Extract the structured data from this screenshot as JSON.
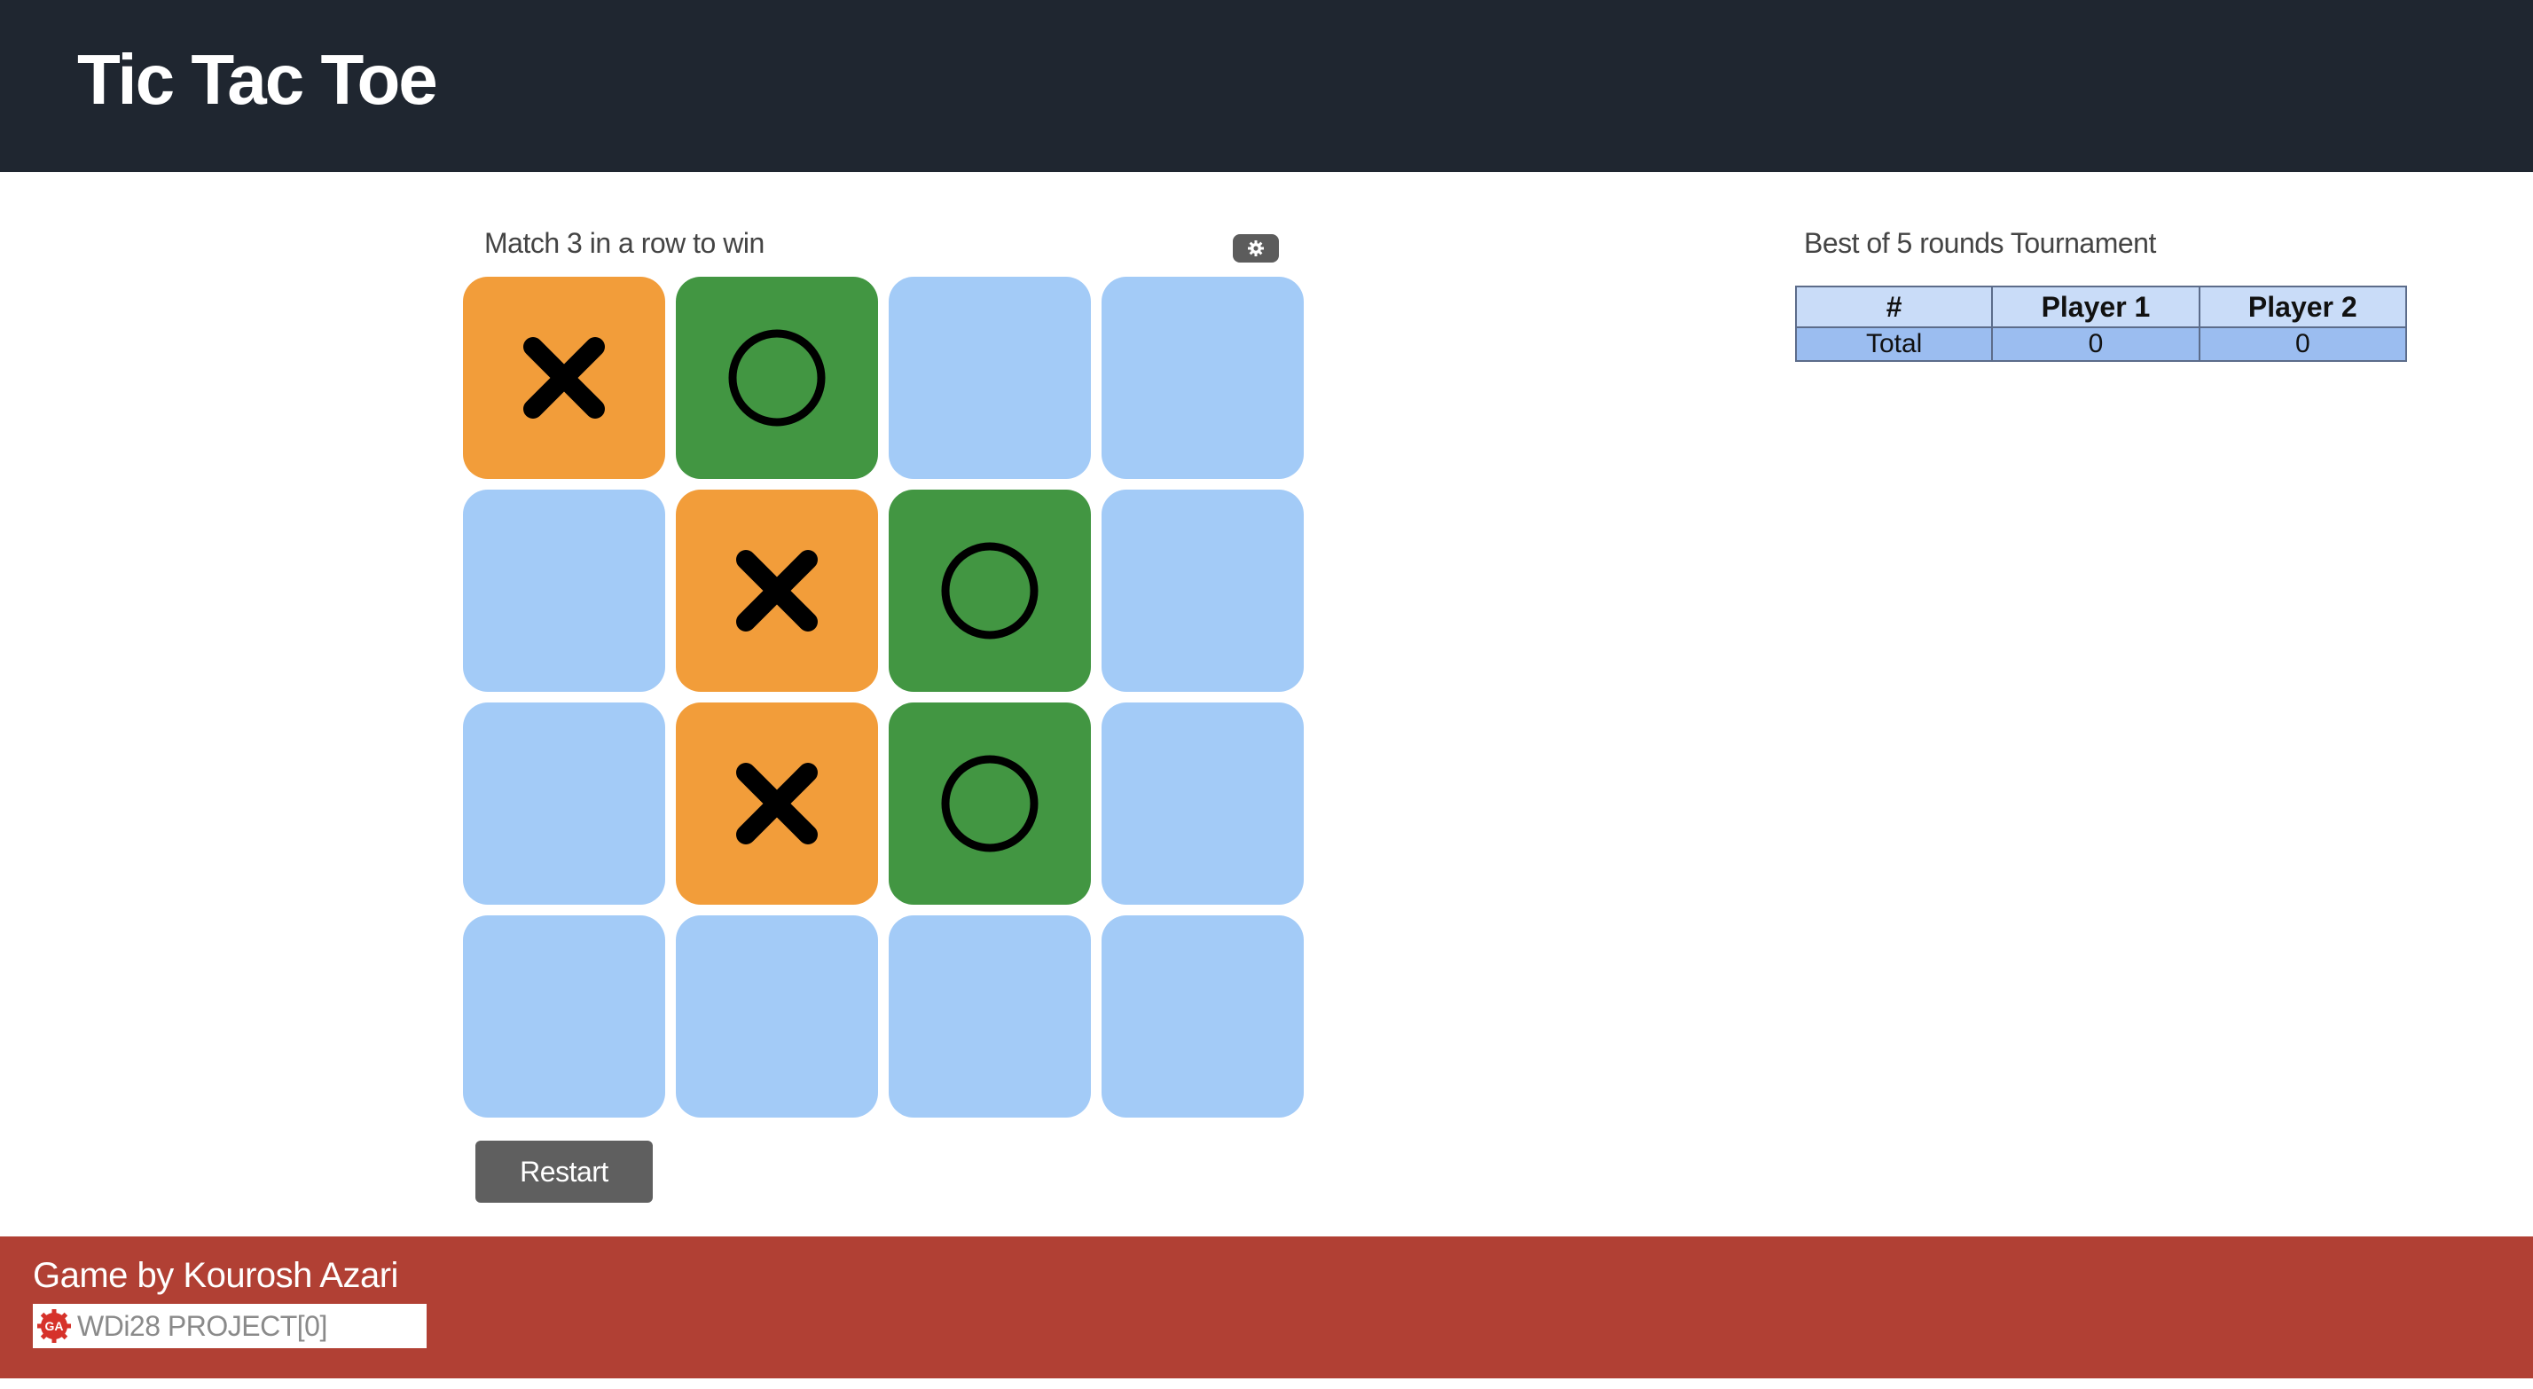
{
  "header": {
    "title": "Tic Tac Toe"
  },
  "game": {
    "subtitle": "Match 3 in a row to win",
    "settings_icon": "gear-icon",
    "restart_label": "Restart",
    "colors": {
      "empty": "#a3cbf7",
      "x": "#f29d3a",
      "o": "#429642",
      "mark": "#000000"
    },
    "board": [
      [
        "X",
        "O",
        "",
        ""
      ],
      [
        "",
        "X",
        "O",
        ""
      ],
      [
        "",
        "X",
        "O",
        ""
      ],
      [
        "",
        "",
        "",
        ""
      ]
    ]
  },
  "tournament": {
    "title": "Best of 5 rounds Tournament",
    "headers": [
      "#",
      "Player 1",
      "Player 2"
    ],
    "rows": [
      [
        "Total",
        "0",
        "0"
      ]
    ]
  },
  "footer": {
    "author": "Game by Kourosh Azari",
    "badge_text": "WDi28 PROJECT[0]",
    "badge_icon": "ga-logo-icon",
    "badge_logo_text": "GA"
  }
}
